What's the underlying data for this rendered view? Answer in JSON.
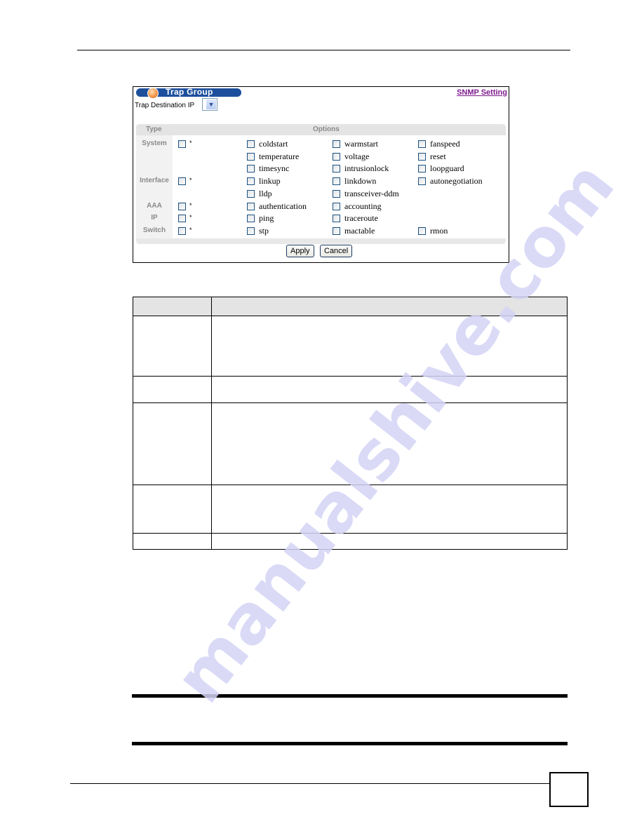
{
  "screenshot": {
    "title": "Trap Group",
    "link": "SNMP Setting",
    "destination_label": "Trap Destination IP",
    "destination_value": "",
    "headers": {
      "type": "Type",
      "options": "Options"
    },
    "star_symbol": "*",
    "groups": [
      {
        "label": "System",
        "options": [
          "coldstart",
          "warmstart",
          "fanspeed",
          "temperature",
          "voltage",
          "reset",
          "timesync",
          "intrusionlock",
          "loopguard"
        ]
      },
      {
        "label": "Interface",
        "options": [
          "linkup",
          "linkdown",
          "autonegotiation",
          "lldp",
          "transceiver-ddm"
        ]
      },
      {
        "label": "AAA",
        "options": [
          "authentication",
          "accounting"
        ]
      },
      {
        "label": "IP",
        "options": [
          "ping",
          "traceroute"
        ]
      },
      {
        "label": "Switch",
        "options": [
          "stp",
          "mactable",
          "rmon"
        ]
      }
    ],
    "buttons": {
      "apply": "Apply",
      "cancel": "Cancel"
    }
  },
  "colors": {
    "title_bar": "#1d4f9c",
    "link": "#7d1a8c",
    "header_gray": "#e4e4e4",
    "watermark": "#d4d4f6"
  },
  "watermark": "manualshive.com"
}
